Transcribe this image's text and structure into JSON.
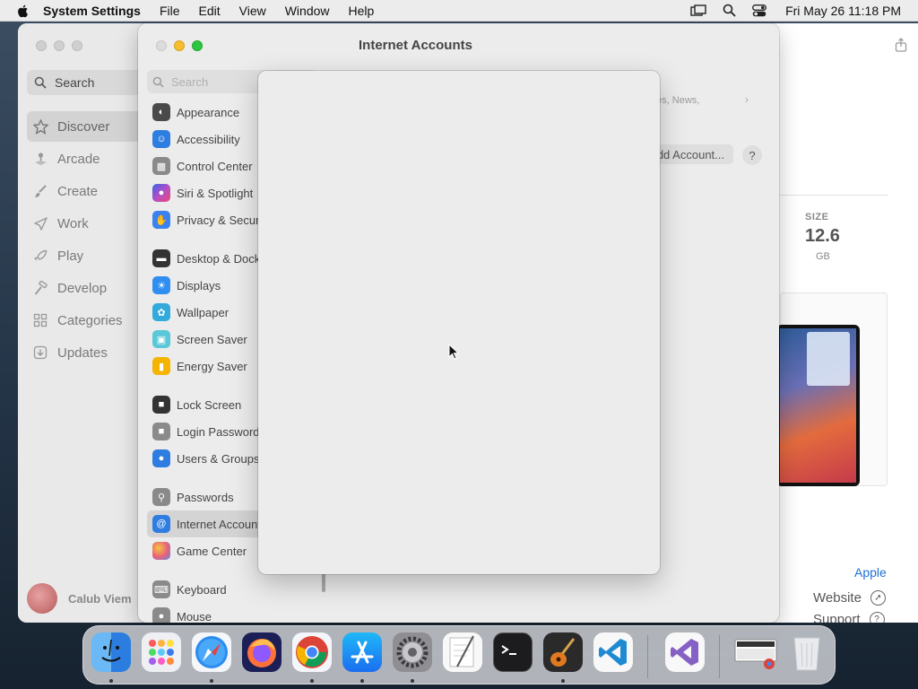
{
  "menubar": {
    "app_name": "System Settings",
    "menus": [
      "File",
      "Edit",
      "View",
      "Window",
      "Help"
    ],
    "clock": "Fri May 26  11:18 PM"
  },
  "appstore": {
    "search_label": "Search",
    "nav": [
      {
        "label": "Discover",
        "icon": "star-icon"
      },
      {
        "label": "Arcade",
        "icon": "joystick-icon"
      },
      {
        "label": "Create",
        "icon": "brush-icon"
      },
      {
        "label": "Work",
        "icon": "paperplane-icon"
      },
      {
        "label": "Play",
        "icon": "rocket-icon"
      },
      {
        "label": "Develop",
        "icon": "hammer-icon"
      },
      {
        "label": "Categories",
        "icon": "grid-icon"
      },
      {
        "label": "Updates",
        "icon": "download-icon"
      }
    ],
    "user_name": "Calub Viem",
    "size_label": "SIZE",
    "size_value": "12.6",
    "size_unit": "GB",
    "developer": "Apple",
    "website": "Website",
    "support": "Support"
  },
  "settings": {
    "title": "Internet Accounts",
    "search_placeholder": "Search",
    "group1": [
      {
        "label": "Appearance",
        "color": "#4a4a4a"
      },
      {
        "label": "Accessibility",
        "color": "#2e7de0"
      },
      {
        "label": "Control Center",
        "color": "#8a8a8a"
      },
      {
        "label": "Siri & Spotlight",
        "color": "#b24fc7"
      },
      {
        "label": "Privacy & Security",
        "color": "#3b82f0"
      }
    ],
    "group2": [
      {
        "label": "Desktop & Dock",
        "color": "#333333"
      },
      {
        "label": "Displays",
        "color": "#2f8ef0"
      },
      {
        "label": "Wallpaper",
        "color": "#34aadc"
      },
      {
        "label": "Screen Saver",
        "color": "#5ac8d8"
      },
      {
        "label": "Energy Saver",
        "color": "#f5b400"
      }
    ],
    "group3": [
      {
        "label": "Lock Screen",
        "color": "#333333"
      },
      {
        "label": "Login Password",
        "color": "#8a8a8a"
      },
      {
        "label": "Users & Groups",
        "color": "#2f7de0"
      }
    ],
    "group4": [
      {
        "label": "Passwords",
        "color": "#8a8a8a"
      },
      {
        "label": "Internet Accounts",
        "color": "#2f7de0"
      },
      {
        "label": "Game Center",
        "color": "#e8607a"
      }
    ],
    "group5": [
      {
        "label": "Keyboard",
        "color": "#8a8a8a"
      },
      {
        "label": "Mouse",
        "color": "#8a8a8a"
      }
    ],
    "content_hint": "tes, News,",
    "add_account": "dd Account...",
    "help": "?"
  },
  "dock": {
    "apps": [
      "Finder",
      "Launchpad",
      "Safari",
      "Firefox",
      "Chrome",
      "App Store",
      "System Settings",
      "TextEdit",
      "Terminal",
      "GarageBand",
      "Visual Studio Code",
      "Visual Studio",
      "Chrome Apps",
      "Trash"
    ]
  }
}
